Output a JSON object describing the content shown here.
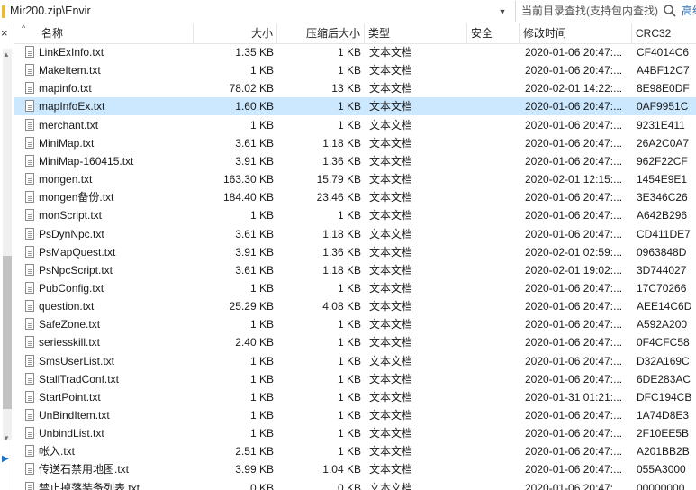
{
  "address": {
    "path": "Mir200.zip\\Envir"
  },
  "search": {
    "placeholder": "当前目录查找(支持包内查找)",
    "advanced_label": "高级"
  },
  "columns": {
    "name": "名称",
    "size": "大小",
    "compressed": "压缩后大小",
    "type": "类型",
    "encrypted": "安全",
    "modified": "修改时间",
    "crc": "CRC32"
  },
  "selected_index": 3,
  "files": [
    {
      "name": "LinkExInfo.txt",
      "size": "1.35 KB",
      "csize": "1 KB",
      "type": "文本文档",
      "modified": "2020-01-06 20:47:...",
      "crc": "CF4014C6"
    },
    {
      "name": "MakeItem.txt",
      "size": "1 KB",
      "csize": "1 KB",
      "type": "文本文档",
      "modified": "2020-01-06 20:47:...",
      "crc": "A4BF12C7"
    },
    {
      "name": "mapinfo.txt",
      "size": "78.02 KB",
      "csize": "13 KB",
      "type": "文本文档",
      "modified": "2020-02-01 14:22:...",
      "crc": "8E98E0DF"
    },
    {
      "name": "mapInfoEx.txt",
      "size": "1.60 KB",
      "csize": "1 KB",
      "type": "文本文档",
      "modified": "2020-01-06 20:47:...",
      "crc": "0AF9951C"
    },
    {
      "name": "merchant.txt",
      "size": "1 KB",
      "csize": "1 KB",
      "type": "文本文档",
      "modified": "2020-01-06 20:47:...",
      "crc": "9231E411"
    },
    {
      "name": "MiniMap.txt",
      "size": "3.61 KB",
      "csize": "1.18 KB",
      "type": "文本文档",
      "modified": "2020-01-06 20:47:...",
      "crc": "26A2C0A7"
    },
    {
      "name": "MiniMap-160415.txt",
      "size": "3.91 KB",
      "csize": "1.36 KB",
      "type": "文本文档",
      "modified": "2020-01-06 20:47:...",
      "crc": "962F22CF"
    },
    {
      "name": "mongen.txt",
      "size": "163.30 KB",
      "csize": "15.79 KB",
      "type": "文本文档",
      "modified": "2020-02-01 12:15:...",
      "crc": "1454E9E1"
    },
    {
      "name": "mongen备份.txt",
      "size": "184.40 KB",
      "csize": "23.46 KB",
      "type": "文本文档",
      "modified": "2020-01-06 20:47:...",
      "crc": "3E346C26"
    },
    {
      "name": "monScript.txt",
      "size": "1 KB",
      "csize": "1 KB",
      "type": "文本文档",
      "modified": "2020-01-06 20:47:...",
      "crc": "A642B296"
    },
    {
      "name": "PsDynNpc.txt",
      "size": "3.61 KB",
      "csize": "1.18 KB",
      "type": "文本文档",
      "modified": "2020-01-06 20:47:...",
      "crc": "CD411DE7"
    },
    {
      "name": "PsMapQuest.txt",
      "size": "3.91 KB",
      "csize": "1.36 KB",
      "type": "文本文档",
      "modified": "2020-02-01 02:59:...",
      "crc": "0963848D"
    },
    {
      "name": "PsNpcScript.txt",
      "size": "3.61 KB",
      "csize": "1.18 KB",
      "type": "文本文档",
      "modified": "2020-02-01 19:02:...",
      "crc": "3D744027"
    },
    {
      "name": "PubConfig.txt",
      "size": "1 KB",
      "csize": "1 KB",
      "type": "文本文档",
      "modified": "2020-01-06 20:47:...",
      "crc": "17C70266"
    },
    {
      "name": "question.txt",
      "size": "25.29 KB",
      "csize": "4.08 KB",
      "type": "文本文档",
      "modified": "2020-01-06 20:47:...",
      "crc": "AEE14C6D"
    },
    {
      "name": "SafeZone.txt",
      "size": "1 KB",
      "csize": "1 KB",
      "type": "文本文档",
      "modified": "2020-01-06 20:47:...",
      "crc": "A592A200"
    },
    {
      "name": "seriesskill.txt",
      "size": "2.40 KB",
      "csize": "1 KB",
      "type": "文本文档",
      "modified": "2020-01-06 20:47:...",
      "crc": "0F4CFC58"
    },
    {
      "name": "SmsUserList.txt",
      "size": "1 KB",
      "csize": "1 KB",
      "type": "文本文档",
      "modified": "2020-01-06 20:47:...",
      "crc": "D32A169C"
    },
    {
      "name": "StallTradConf.txt",
      "size": "1 KB",
      "csize": "1 KB",
      "type": "文本文档",
      "modified": "2020-01-06 20:47:...",
      "crc": "6DE283AC"
    },
    {
      "name": "StartPoint.txt",
      "size": "1 KB",
      "csize": "1 KB",
      "type": "文本文档",
      "modified": "2020-01-31 01:21:...",
      "crc": "DFC194CB"
    },
    {
      "name": "UnBindItem.txt",
      "size": "1 KB",
      "csize": "1 KB",
      "type": "文本文档",
      "modified": "2020-01-06 20:47:...",
      "crc": "1A74D8E3"
    },
    {
      "name": "UnbindList.txt",
      "size": "1 KB",
      "csize": "1 KB",
      "type": "文本文档",
      "modified": "2020-01-06 20:47:...",
      "crc": "2F10EE5B"
    },
    {
      "name": "帐入.txt",
      "size": "2.51 KB",
      "csize": "1 KB",
      "type": "文本文档",
      "modified": "2020-01-06 20:47:...",
      "crc": "A201BB2B"
    },
    {
      "name": "传送石禁用地图.txt",
      "size": "3.99 KB",
      "csize": "1.04 KB",
      "type": "文本文档",
      "modified": "2020-01-06 20:47:...",
      "crc": "055A3000"
    },
    {
      "name": "禁止掉落装备列表.txt",
      "size": "0 KB",
      "csize": "0 KB",
      "type": "文本文档",
      "modified": "2020-01-06 20:47:...",
      "crc": "00000000"
    }
  ]
}
